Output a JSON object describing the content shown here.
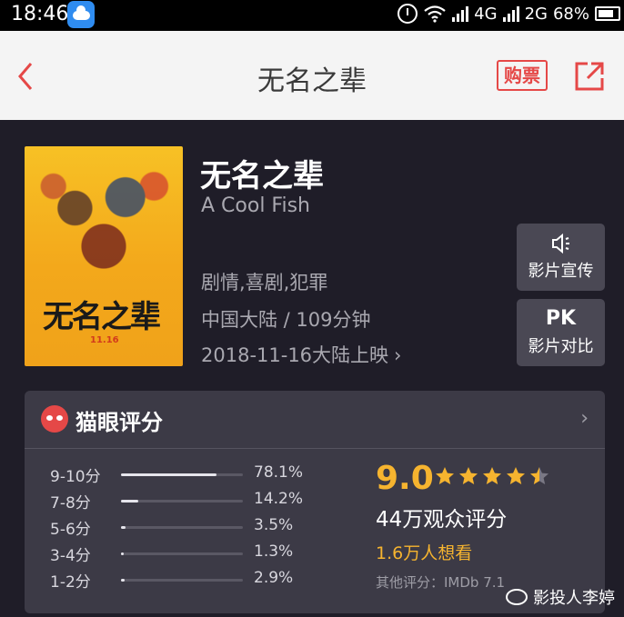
{
  "status_bar": {
    "time": "18:46",
    "network_1": "4G",
    "network_2": "2G",
    "battery": "68%"
  },
  "nav": {
    "title": "无名之辈",
    "buy_label": "购票",
    "accent_color": "#e54847"
  },
  "movie": {
    "name": "无名之辈",
    "en_name": "A Cool Fish",
    "genre": "剧情,喜剧,犯罪",
    "meta": "中国大陆 / 109分钟",
    "release": "2018-11-16大陆上映",
    "poster": {
      "title": "无名之辈",
      "date": "11.16"
    }
  },
  "actions": {
    "promo_label": "影片宣传",
    "pk_icon": "PK",
    "pk_label": "影片对比"
  },
  "rating": {
    "title": "猫眼评分",
    "score": "9.0",
    "stars": 4.5,
    "audience": "44万观众评分",
    "want": "1.6万人想看",
    "other": "其他评分：IMDb 7.1",
    "distribution": [
      {
        "label": "9-10分",
        "pct": "78.1%",
        "value": 78.1
      },
      {
        "label": "7-8分",
        "pct": "14.2%",
        "value": 14.2
      },
      {
        "label": "5-6分",
        "pct": "3.5%",
        "value": 3.5
      },
      {
        "label": "3-4分",
        "pct": "1.3%",
        "value": 1.3
      },
      {
        "label": "1-2分",
        "pct": "2.9%",
        "value": 2.9
      }
    ]
  },
  "watermark": {
    "text": "影投人李婷"
  }
}
